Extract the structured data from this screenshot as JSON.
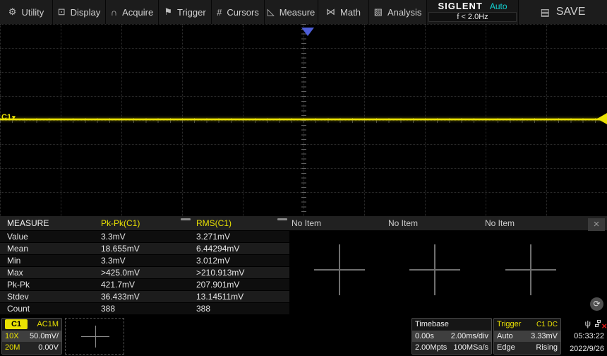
{
  "menu": {
    "items": [
      {
        "label": "Utility",
        "icon": "gear"
      },
      {
        "label": "Display",
        "icon": "display"
      },
      {
        "label": "Acquire",
        "icon": "acquire"
      },
      {
        "label": "Trigger",
        "icon": "flag"
      },
      {
        "label": "Cursors",
        "icon": "cursors"
      },
      {
        "label": "Measure",
        "icon": "measure"
      },
      {
        "label": "Math",
        "icon": "math"
      },
      {
        "label": "Analysis",
        "icon": "analysis"
      }
    ],
    "logo": "SIGLENT",
    "acquisition_status": "Auto",
    "frequency_counter": "f < 2.0Hz",
    "save_label": "SAVE"
  },
  "wave": {
    "channel_marker": "C1"
  },
  "measure": {
    "title": "MEASURE",
    "col1_header": "Pk-Pk(C1)",
    "col2_header": "RMS(C1)",
    "empty_columns": [
      "No Item",
      "No Item",
      "No Item"
    ],
    "close_glyph": "×",
    "rows": [
      {
        "label": "Value",
        "pkpk": "3.3mV",
        "rms": "3.271mV"
      },
      {
        "label": "Mean",
        "pkpk": "18.655mV",
        "rms": "6.44294mV"
      },
      {
        "label": "Min",
        "pkpk": "3.3mV",
        "rms": "3.012mV"
      },
      {
        "label": "Max",
        "pkpk": ">425.0mV",
        "rms": ">210.913mV"
      },
      {
        "label": "Pk-Pk",
        "pkpk": "421.7mV",
        "rms": "207.901mV"
      },
      {
        "label": "Stdev",
        "pkpk": "36.433mV",
        "rms": "13.14511mV"
      },
      {
        "label": "Count",
        "pkpk": "388",
        "rms": "388"
      }
    ]
  },
  "channel": {
    "name": "C1",
    "coupling": "AC1M",
    "probe": "10X",
    "scale": "50.0mV/",
    "bandwidth": "20M",
    "offset": "0.00V"
  },
  "timebase": {
    "label": "Timebase",
    "delay": "0.00s",
    "scale": "2.00ms/div",
    "memory": "2.00Mpts",
    "samplerate": "100MSa/s"
  },
  "trigger": {
    "label": "Trigger",
    "source": "C1 DC",
    "mode": "Auto",
    "level": "3.33mV",
    "type": "Edge",
    "slope": "Rising"
  },
  "status": {
    "time": "05:33:22",
    "date": "2022/9/26"
  },
  "colors": {
    "channel_yellow": "#e9e103",
    "accent_cyan": "#12d2d2",
    "trigger_blue": "#4e5ed8"
  }
}
